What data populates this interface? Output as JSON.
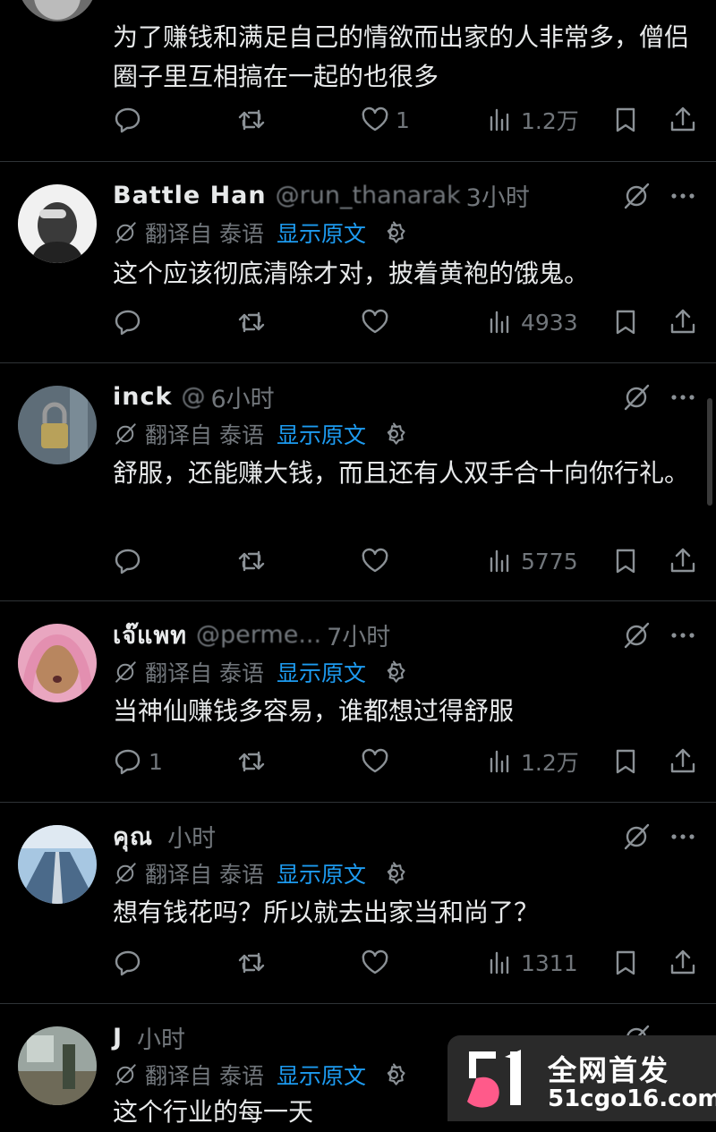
{
  "translate": {
    "label": "翻译自 泰语",
    "show_original": "显示原文"
  },
  "posts": [
    {
      "name": "",
      "handle": "",
      "time": "",
      "text": "为了赚钱和满足自己的情欲而出家的人非常多，僧侣圈子里互相搞在一起的也很多",
      "reply_count": "",
      "like_count": "1",
      "view_count": "1.2万"
    },
    {
      "name": "Battle Han",
      "handle": "@run_thanarak",
      "time": "3小时",
      "text": "这个应该彻底清除才对，披着黄袍的饿鬼。",
      "reply_count": "",
      "like_count": "",
      "view_count": "4933"
    },
    {
      "name": "inck",
      "handle": "@",
      "time": "6小时",
      "text": "舒服，还能赚大钱，而且还有人双手合十向你行礼。",
      "reply_count": "",
      "like_count": "",
      "view_count": "5775"
    },
    {
      "name": "เจ๊แพท",
      "handle": "@perme...",
      "time": "7小时",
      "text": "当神仙赚钱多容易，谁都想过得舒服",
      "reply_count": "1",
      "like_count": "",
      "view_count": "1.2万"
    },
    {
      "name": "คุณ",
      "handle": "",
      "time": "小时",
      "text": "想有钱花吗？所以就去出家当和尚了？",
      "reply_count": "",
      "like_count": "",
      "view_count": "1311"
    },
    {
      "name": "J",
      "handle": "",
      "time": "小时",
      "text": "这个行业的每一天",
      "reply_count": "",
      "like_count": "",
      "view_count": ""
    }
  ],
  "watermark": {
    "title": "全网首发",
    "site": "51cgo16.com"
  },
  "colors": {
    "background": "#000000",
    "text": "#e7e9ea",
    "muted": "#71767b",
    "link": "#1d9bf0",
    "divider": "#2f3336"
  }
}
